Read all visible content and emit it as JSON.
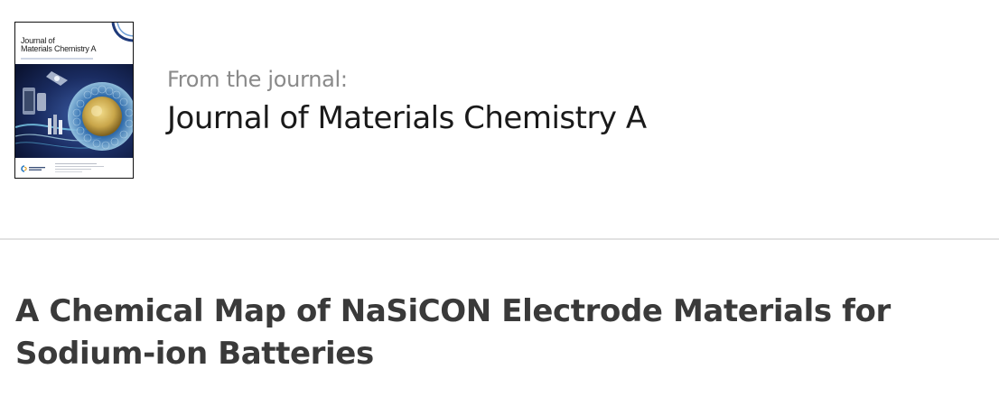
{
  "journal": {
    "from_label": "From the journal:",
    "name": "Journal of Materials Chemistry A",
    "cover": {
      "title": "Journal of Materials Chemistry A",
      "title_line1": "Journal of",
      "title_line2": "Materials Chemistry A",
      "publisher_logo": "ROYAL SOCIETY OF CHEMISTRY"
    }
  },
  "article": {
    "title": "A Chemical Map of NaSiCON Electrode Materials for Sodium-ion Batteries"
  },
  "colors": {
    "divider": "#e2e2e2",
    "from_label": "#8a8a8a",
    "journal_name": "#1a1a1a",
    "article_title": "#3a3a3a",
    "cover_art_dark": "#0f1c3f",
    "cover_art_teal": "#2fa6c8",
    "cover_art_gold": "#c9a64a"
  }
}
